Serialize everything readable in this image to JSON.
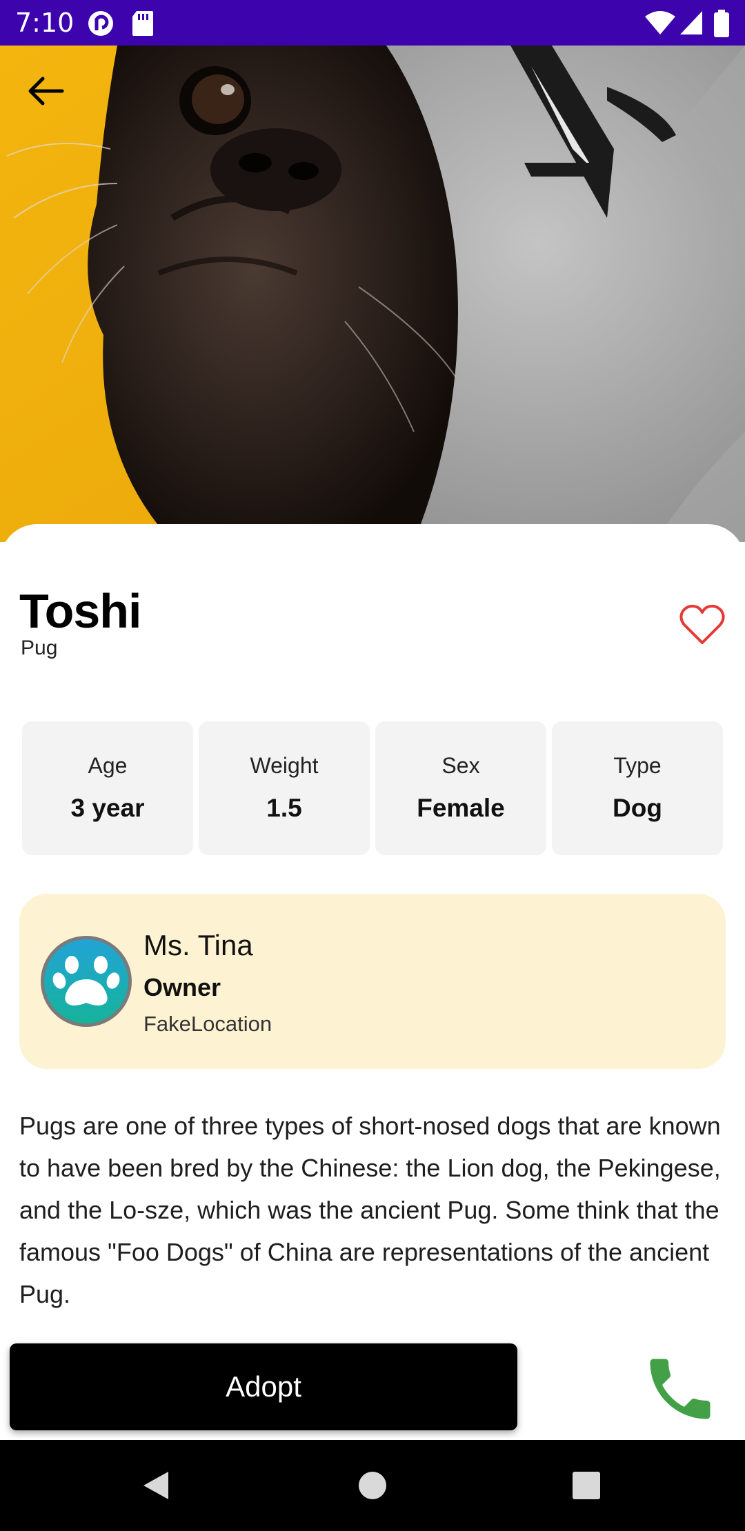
{
  "status_bar": {
    "time": "7:10",
    "left_icons": [
      "pocket-casts-icon",
      "sd-card-icon"
    ],
    "right_icons": [
      "wifi-icon",
      "cellular-signal-icon",
      "battery-icon"
    ],
    "background_color": "#3d03ad"
  },
  "hero": {
    "image_subject": "pug wearing a grey hoodie on a yellow background",
    "back_icon": "arrow-left-icon",
    "background_color": "#f0b20c"
  },
  "pet": {
    "name": "Toshi",
    "breed": "Pug",
    "favorite_icon": "heart-outline-icon",
    "favorite_color": "#e53935"
  },
  "stats": [
    {
      "label": "Age",
      "value": "3 year"
    },
    {
      "label": "Weight",
      "value": "1.5"
    },
    {
      "label": "Sex",
      "value": "Female"
    },
    {
      "label": "Type",
      "value": "Dog"
    }
  ],
  "owner": {
    "name": "Ms. Tina",
    "role": "Owner",
    "location": "FakeLocation",
    "avatar_icon": "paw-icon",
    "card_color": "#fdf3d2"
  },
  "description": "Pugs are one of three types of short-nosed dogs that are known to have been bred by the Chinese: the Lion dog, the Pekingese, and the Lo-sze, which was the ancient Pug. Some think that the famous \"Foo Dogs\" of China are representations of the ancient Pug.",
  "actions": {
    "adopt_label": "Adopt",
    "call_icon": "phone-icon",
    "call_color": "#43a047"
  },
  "nav_bar": {
    "icons": [
      "back-triangle-icon",
      "home-circle-icon",
      "recents-square-icon"
    ]
  }
}
